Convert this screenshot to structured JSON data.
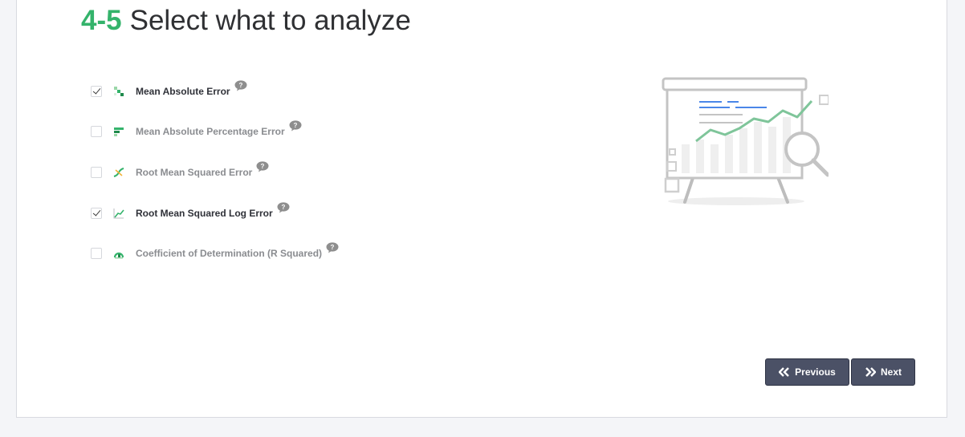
{
  "page": {
    "step": "4-5",
    "title": "Select what to analyze"
  },
  "metrics": [
    {
      "label": "Mean Absolute Error",
      "checked": true,
      "icon": "mae-icon"
    },
    {
      "label": "Mean Absolute Percentage Error",
      "checked": false,
      "icon": "mape-icon"
    },
    {
      "label": "Root Mean Squared Error",
      "checked": false,
      "icon": "rmse-icon"
    },
    {
      "label": "Root Mean Squared Log Error",
      "checked": true,
      "icon": "rmsle-icon"
    },
    {
      "label": "Coefficient of Determination (R Squared)",
      "checked": false,
      "icon": "r-squared-icon"
    }
  ],
  "help_icon": "question-bubble-icon",
  "illustration_icon": "presentation-board-analysis-icon",
  "buttons": {
    "previous": "Previous",
    "next": "Next"
  },
  "colors": {
    "accent_green": "#34b36b",
    "button_bg": "#4b5166",
    "page_bg": "#f4f5f8"
  }
}
